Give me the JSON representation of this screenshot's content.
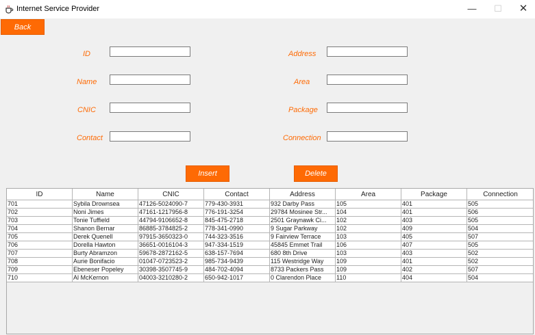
{
  "window": {
    "title": "Internet Service Provider",
    "controls": {
      "minimize": "—",
      "maximize": "☐",
      "close": "✕"
    }
  },
  "back_label": "Back",
  "form": {
    "id_label": "ID",
    "name_label": "Name",
    "cnic_label": "CNIC",
    "contact_label": "Contact",
    "address_label": "Address",
    "area_label": "Area",
    "package_label": "Package",
    "connection_label": "Connection"
  },
  "actions": {
    "insert_label": "Insert",
    "delete_label": "Delete"
  },
  "accent_color": "#fe6a04",
  "table": {
    "columns": [
      "ID",
      "Name",
      "CNIC",
      "Contact",
      "Address",
      "Area",
      "Package",
      "Connection"
    ],
    "rows": [
      [
        "701",
        "Sybila Drownsea",
        "47126-5024090-7",
        "779-430-3931",
        "932 Darby Pass",
        "105",
        "401",
        "505"
      ],
      [
        "702",
        "Noni Jimes",
        "47161-1217956-8",
        "776-191-3254",
        "29784 Mosinee Str...",
        "104",
        "401",
        "506"
      ],
      [
        "703",
        "Tonie Tuffield",
        "44794-9106652-8",
        "845-475-2718",
        "2501 Graynawk Ci...",
        "102",
        "403",
        "505"
      ],
      [
        "704",
        "Shanon Bernar",
        "86885-3784825-2",
        "778-341-0990",
        "9 Sugar Parkway",
        "102",
        "409",
        "504"
      ],
      [
        "705",
        "Derek Quenell",
        "97915-3650323-0",
        "744-323-3516",
        "9 Fairview Terrace",
        "103",
        "405",
        "507"
      ],
      [
        "706",
        "Dorella Hawton",
        "36651-0016104-3",
        "947-334-1519",
        "45845 Emmet Trail",
        "106",
        "407",
        "505"
      ],
      [
        "707",
        "Burty Abramzon",
        "59678-2872162-5",
        "638-157-7694",
        "680 8th Drive",
        "103",
        "403",
        "502"
      ],
      [
        "708",
        "Aurie Bonifacio",
        "01047-0723523-2",
        "985-734-9439",
        "115 Westridge Way",
        "109",
        "401",
        "502"
      ],
      [
        "709",
        "Ebeneser Popeley",
        "30398-3507745-9",
        "484-702-4094",
        "8733 Packers Pass",
        "109",
        "402",
        "507"
      ],
      [
        "710",
        "Al McKernon",
        "04003-3210280-2",
        "650-942-1017",
        "0 Clarendon Place",
        "110",
        "404",
        "504"
      ]
    ]
  }
}
